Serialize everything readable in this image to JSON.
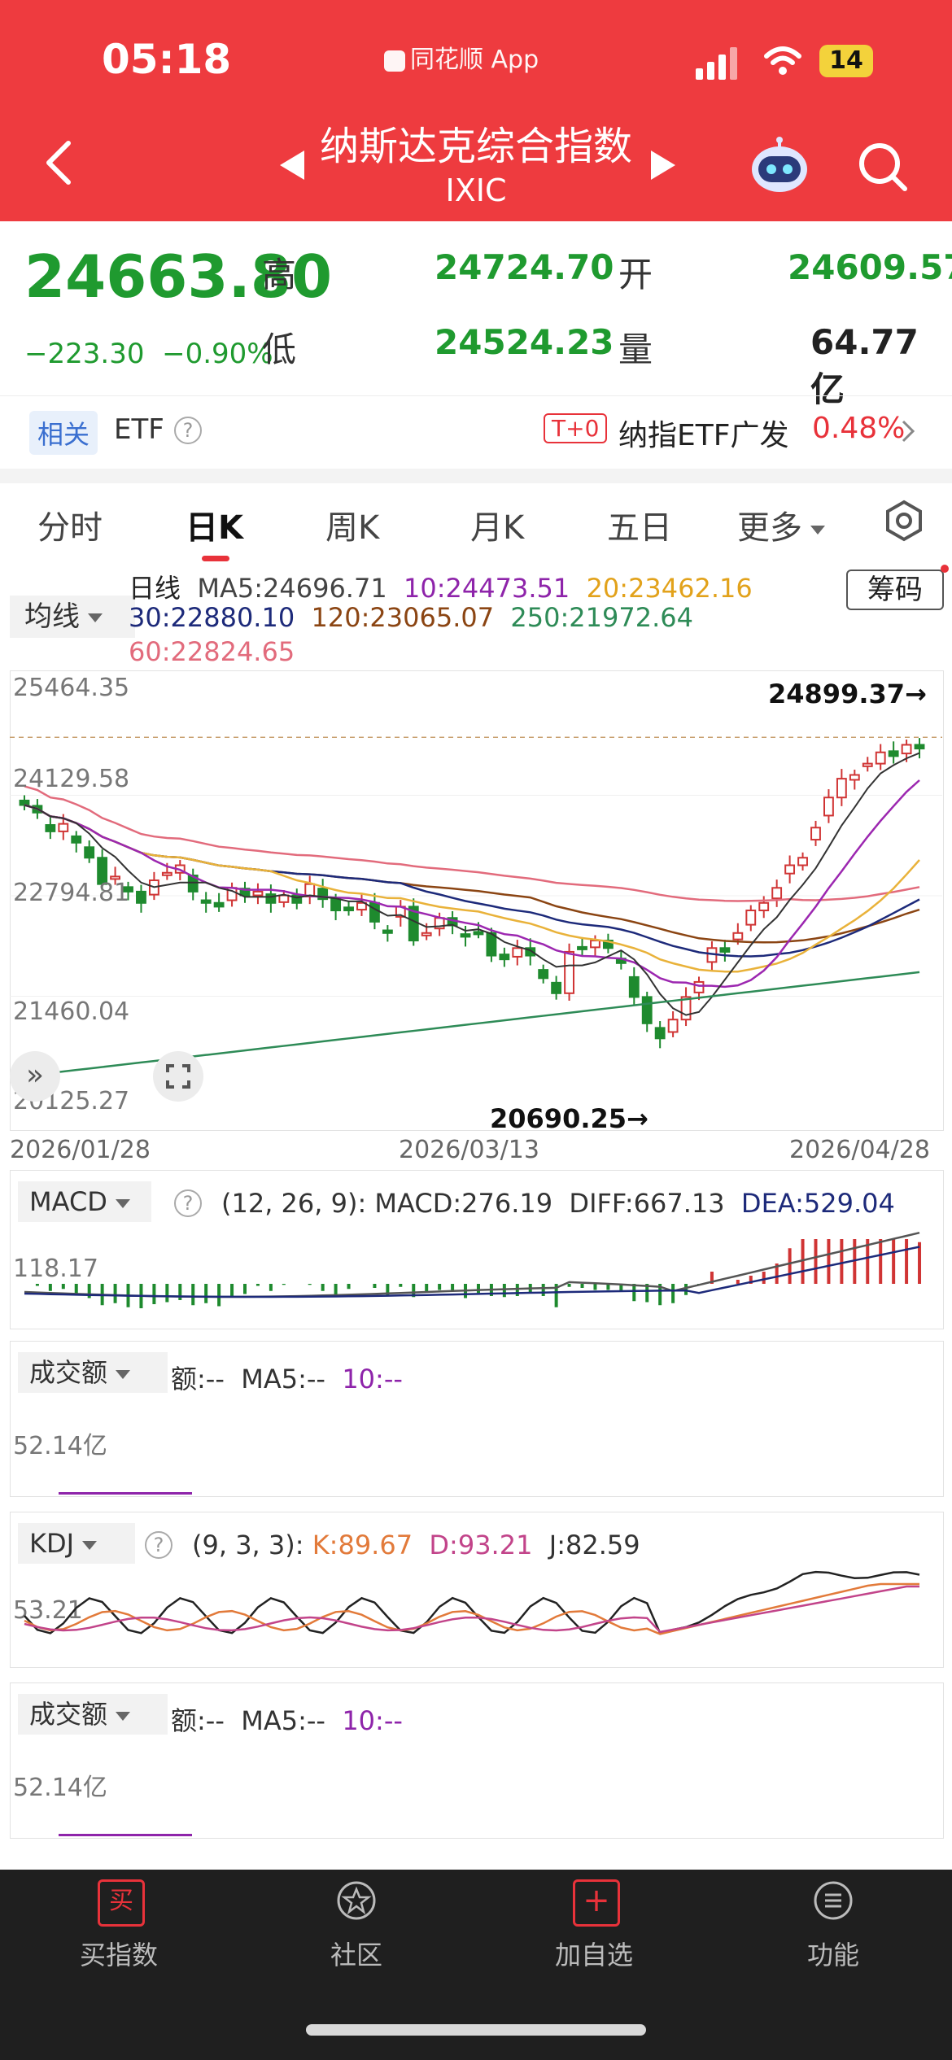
{
  "status_bar": {
    "time": "05:18",
    "app_label": "同花顺 App",
    "battery": "14"
  },
  "header": {
    "title": "纳斯达克综合指数",
    "code": "IXIC"
  },
  "quote": {
    "price": "24663.80",
    "change": "−223.30",
    "change_pct": "−0.90%",
    "high_label": "高",
    "high": "24724.70",
    "open_label": "开",
    "open": "24609.57",
    "low_label": "低",
    "low": "24524.23",
    "volume_label": "量",
    "volume": "64.77亿"
  },
  "etf": {
    "tag": "相关",
    "label": "ETF",
    "t0": "T+0",
    "name": "纳指ETF广发",
    "pct": "0.48%"
  },
  "tabs": [
    "分时",
    "日K",
    "周K",
    "月K",
    "五日",
    "更多"
  ],
  "ma": {
    "button": "均线",
    "period": "日线",
    "ma5": "MA5:24696.71",
    "ma10": "10:24473.51",
    "ma20": "20:23462.16",
    "ma30": "30:22880.10",
    "ma120": "120:23065.07",
    "ma250": "250:21972.64",
    "ma60": "60:22824.65",
    "chip_button": "筹码"
  },
  "chart_data": {
    "type": "candlestick",
    "y_ticks": [
      "25464.35",
      "24129.58",
      "22794.81",
      "21460.04",
      "20125.27"
    ],
    "x_labels": [
      "2026/01/28",
      "2026/03/13",
      "2026/04/28"
    ],
    "high_marker": "24899.37→",
    "low_marker": "20690.25→",
    "ylim": [
      20125.27,
      25464.35
    ],
    "colors": {
      "up": "#d03434",
      "down": "#1e8a2e",
      "ma5": "#333333",
      "ma10": "#9c27b0",
      "ma20": "#e9b23a",
      "ma30": "#1d2a7a",
      "ma60": "#e26b7c",
      "ma120": "#8b4513",
      "ma250": "#2e8b57"
    },
    "closes": [
      24000,
      23900,
      23650,
      23750,
      23500,
      23300,
      22950,
      23050,
      22850,
      22700,
      23000,
      23100,
      23200,
      22850,
      22700,
      22650,
      22900,
      22800,
      22850,
      22700,
      22800,
      22700,
      22950,
      22750,
      22600,
      22600,
      22700,
      22450,
      22300,
      22650,
      22200,
      22300,
      22500,
      22400,
      22250,
      22300,
      22000,
      21950,
      22100,
      22000,
      21700,
      21500,
      22050,
      22100,
      22200,
      22100,
      21900,
      21450,
      21100,
      20900,
      21150,
      21450,
      21650,
      22100,
      22050,
      22300,
      22600,
      22700,
      22900,
      23200,
      23300,
      23700,
      24100,
      24350,
      24400,
      24550,
      24700,
      24650,
      24800,
      24750
    ],
    "macd": {
      "params": "(12, 26, 9):",
      "macd": "MACD:276.19",
      "diff": "DIFF:667.13",
      "dea": "DEA:529.04",
      "y_label": "118.17"
    },
    "kdj": {
      "params": "(9, 3, 3):",
      "k": "K:89.67",
      "d": "D:93.21",
      "j": "J:82.59",
      "y_label": "53.21"
    }
  },
  "volume_panel": {
    "button": "成交额",
    "amount": "额:--",
    "ma5": "MA5:--",
    "ma10": "10:--",
    "y_label": "52.14亿"
  },
  "macd_panel": {
    "button": "MACD"
  },
  "kdj_panel": {
    "button": "KDJ"
  },
  "volume_panel2": {
    "button": "成交额",
    "amount": "额:--",
    "ma5": "MA5:--",
    "ma10": "10:--",
    "y_label": "52.14亿"
  },
  "bottom_nav": [
    {
      "label": "买指数",
      "icon": "buy-icon"
    },
    {
      "label": "社区",
      "icon": "community-icon"
    },
    {
      "label": "加自选",
      "icon": "add-watchlist-icon"
    },
    {
      "label": "功能",
      "icon": "menu-icon"
    }
  ]
}
